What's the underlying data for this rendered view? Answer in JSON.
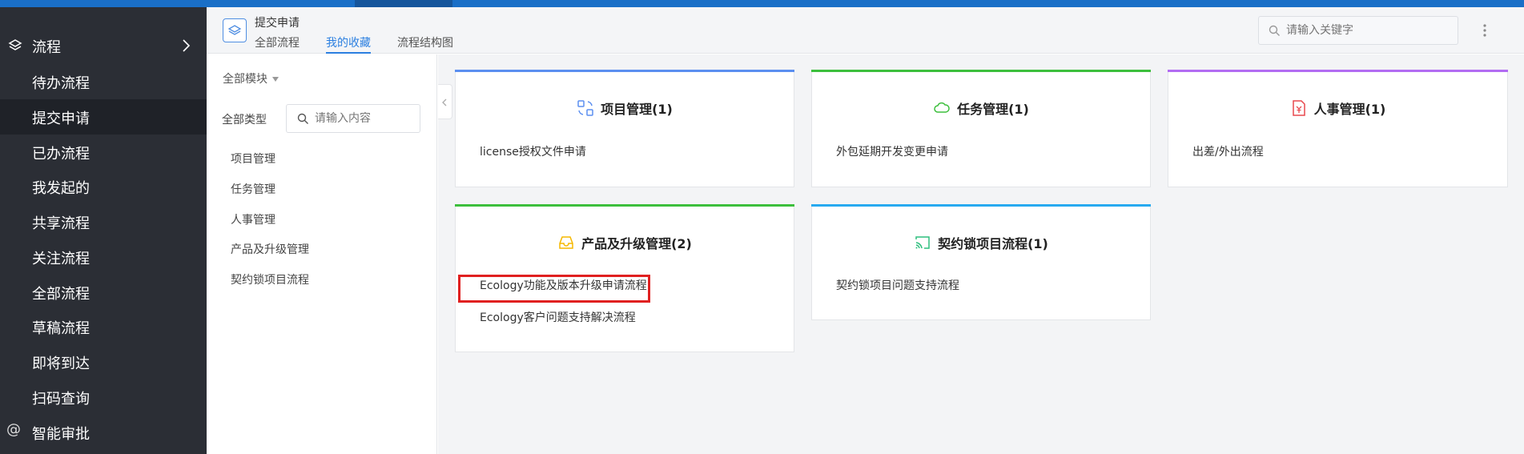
{
  "sidebar": {
    "header_label": "流程",
    "items": [
      {
        "label": "待办流程"
      },
      {
        "label": "提交申请"
      },
      {
        "label": "已办流程"
      },
      {
        "label": "我发起的"
      },
      {
        "label": "共享流程"
      },
      {
        "label": "关注流程"
      },
      {
        "label": "全部流程"
      },
      {
        "label": "草稿流程"
      },
      {
        "label": "即将到达"
      },
      {
        "label": "扫码查询"
      },
      {
        "label": "智能审批"
      }
    ],
    "active_item": "提交申请"
  },
  "header": {
    "title": "提交申请",
    "tabs": [
      {
        "label": "全部流程"
      },
      {
        "label": "我的收藏"
      },
      {
        "label": "流程结构图"
      }
    ],
    "active_tab": "我的收藏",
    "search_placeholder": "请输入关键字"
  },
  "filter": {
    "module_select": "全部模块",
    "type_label": "全部类型",
    "search_placeholder": "请输入内容",
    "categories": [
      "项目管理",
      "任务管理",
      "人事管理",
      "产品及升级管理",
      "契约锁项目流程"
    ]
  },
  "cards": [
    {
      "title": "项目管理(1)",
      "icon": "project-icon",
      "color": "#5b8ff0",
      "links": [
        "license授权文件申请"
      ]
    },
    {
      "title": "任务管理(1)",
      "icon": "cloud-icon",
      "color": "#3dbf3d",
      "links": [
        "外包延期开发变更申请"
      ]
    },
    {
      "title": "人事管理(1)",
      "icon": "document-yen-icon",
      "color": "#b26cf2",
      "links": [
        "出差/外出流程"
      ]
    },
    {
      "title": "产品及升级管理(2)",
      "icon": "inbox-icon",
      "color": "#3dbf3d",
      "links": [
        "Ecology功能及版本升级申请流程",
        "Ecology客户问题支持解决流程"
      ]
    },
    {
      "title": "契约锁项目流程(1)",
      "icon": "cast-icon",
      "color": "#27aaf0",
      "links": [
        "契约锁项目问题支持流程"
      ]
    }
  ],
  "highlight_color": "#e02020"
}
